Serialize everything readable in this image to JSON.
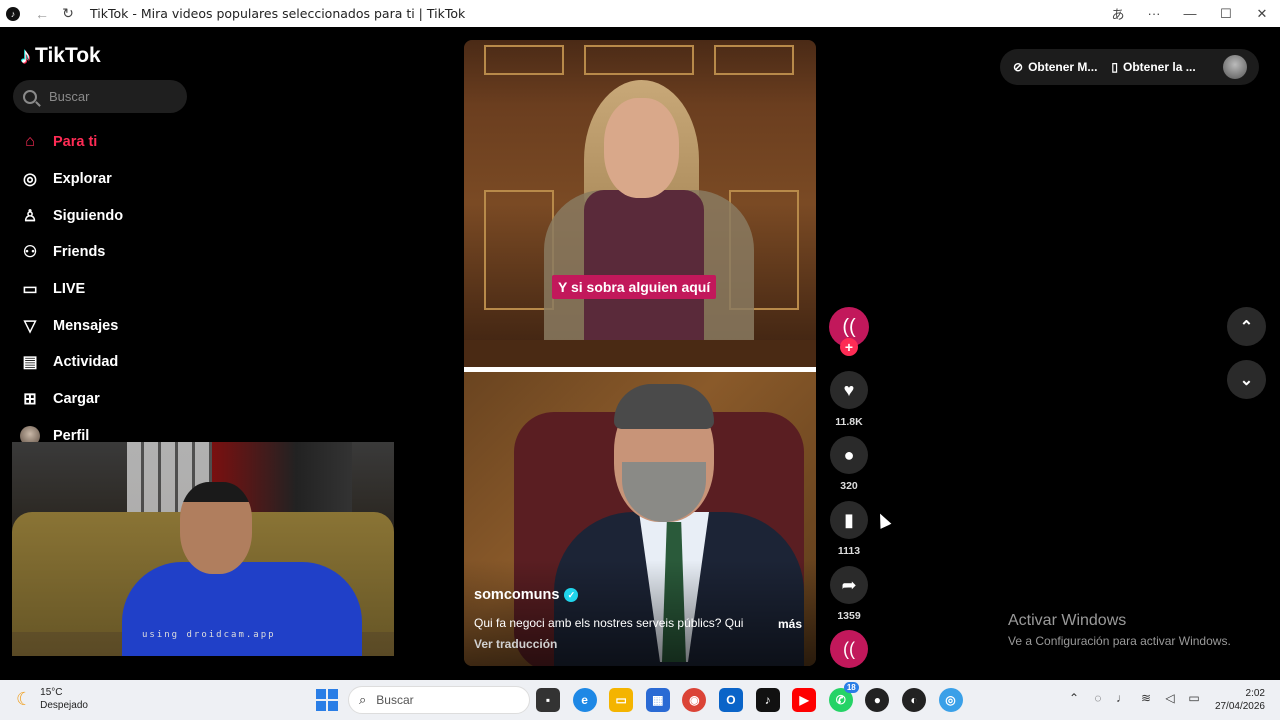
{
  "browser": {
    "title": "TikTok - Mira videos populares seleccionados para ti | TikTok"
  },
  "sidebar": {
    "logo": "TikTok",
    "search_placeholder": "Buscar",
    "items": [
      {
        "label": "Para ti",
        "icon": "home-icon",
        "active": true
      },
      {
        "label": "Explorar",
        "icon": "compass-icon",
        "active": false
      },
      {
        "label": "Siguiendo",
        "icon": "following-icon",
        "active": false
      },
      {
        "label": "Friends",
        "icon": "friends-icon",
        "active": false
      },
      {
        "label": "LIVE",
        "icon": "live-icon",
        "active": false
      },
      {
        "label": "Mensajes",
        "icon": "messages-icon",
        "active": false
      },
      {
        "label": "Actividad",
        "icon": "activity-icon",
        "active": false
      },
      {
        "label": "Cargar",
        "icon": "upload-icon",
        "active": false
      },
      {
        "label": "Perfil",
        "icon": "avatar",
        "active": false
      }
    ]
  },
  "webcam": {
    "watermark": "using droidcam.app"
  },
  "video": {
    "caption": "Y si sobra alguien aquí",
    "author": "somcomuns",
    "description": "Qui fa negoci amb els nostres serveis públics? Qui",
    "more": "más",
    "translate": "Ver traducción"
  },
  "actions": {
    "likes": "11.8K",
    "comments": "320",
    "saves": "1113",
    "shares": "1359"
  },
  "topbar": {
    "btn1": "Obtener M...",
    "btn2": "Obtener la ..."
  },
  "activation": {
    "line1": "Activar Windows",
    "line2": "Ve a Configuración para activar Windows."
  },
  "taskbar": {
    "temp": "15°C",
    "weather": "Despejado",
    "search": "Buscar",
    "badge": "18",
    "time": "2:02",
    "date": "27/04/2026"
  },
  "colors": {
    "accent": "#fe2c55",
    "caption_bg": "#c2185b"
  }
}
